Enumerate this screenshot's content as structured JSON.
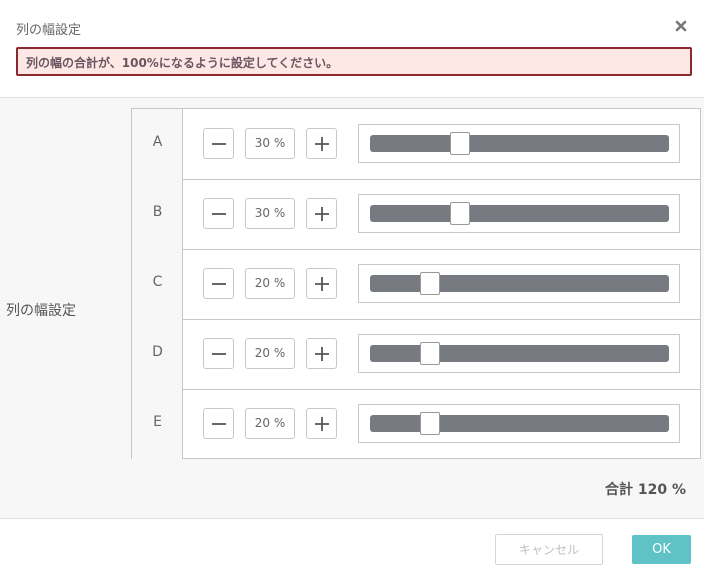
{
  "dialog": {
    "title": "列の幅設定",
    "error_message": "列の幅の合計が、100%になるように設定してください。",
    "section_label": "列の幅設定",
    "total_text": "合計 120 %",
    "cancel_label": "キャンセル",
    "ok_label": "OK"
  },
  "columns": [
    {
      "name": "A",
      "percent_text": "30 %",
      "percent": 30
    },
    {
      "name": "B",
      "percent_text": "30 %",
      "percent": 30
    },
    {
      "name": "C",
      "percent_text": "20 %",
      "percent": 20
    },
    {
      "name": "D",
      "percent_text": "20 %",
      "percent": 20
    },
    {
      "name": "E",
      "percent_text": "20 %",
      "percent": 20
    }
  ],
  "colors": {
    "error_border": "#8a2a30",
    "error_background": "#fde8e6",
    "slider_track": "#777a80",
    "ok_button": "#5fc2c4"
  },
  "icons": {
    "close": "close-icon",
    "minus": "minus-icon",
    "plus": "plus-icon"
  }
}
